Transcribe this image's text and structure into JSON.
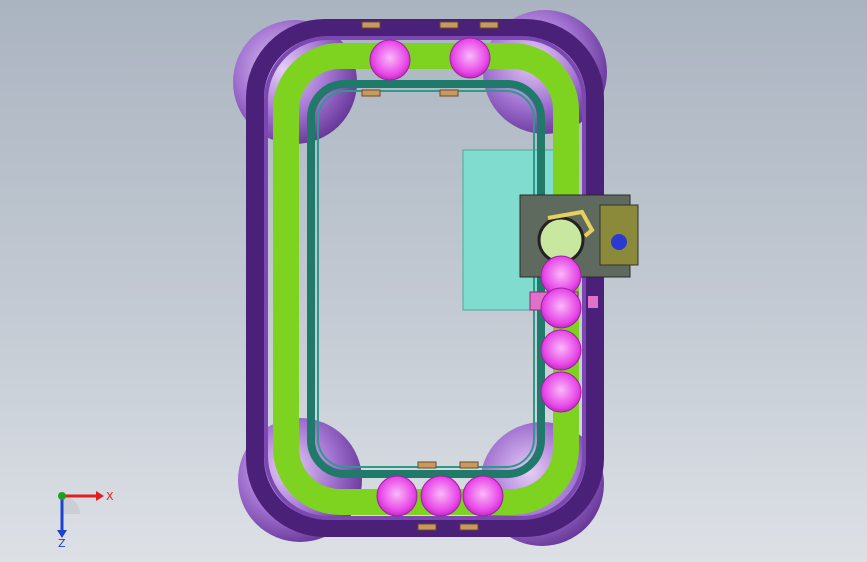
{
  "viewport": {
    "background_top": "#aab4c0",
    "background_bottom": "#dde1e6"
  },
  "colors": {
    "outer_rail": "#5a2a8a",
    "outer_rail_dark": "#3d1866",
    "track_green": "#7ed321",
    "inner_rail": "#1f7a6a",
    "corner_wheel": "#8a4fc0",
    "corner_wheel_light": "#d9b8f0",
    "carrier_pink": "#e040e0",
    "carrier_pink_light": "#f7a8f7",
    "panel_cyan": "#7fdccf",
    "station_olive": "#8a8a3a",
    "axis_x": "#e02020",
    "axis_y": "#20a020",
    "axis_z": "#2040d0"
  },
  "triad": {
    "x_label": "X",
    "z_label": "Z"
  },
  "icons": {
    "triad": "coordinate-triad-icon"
  }
}
